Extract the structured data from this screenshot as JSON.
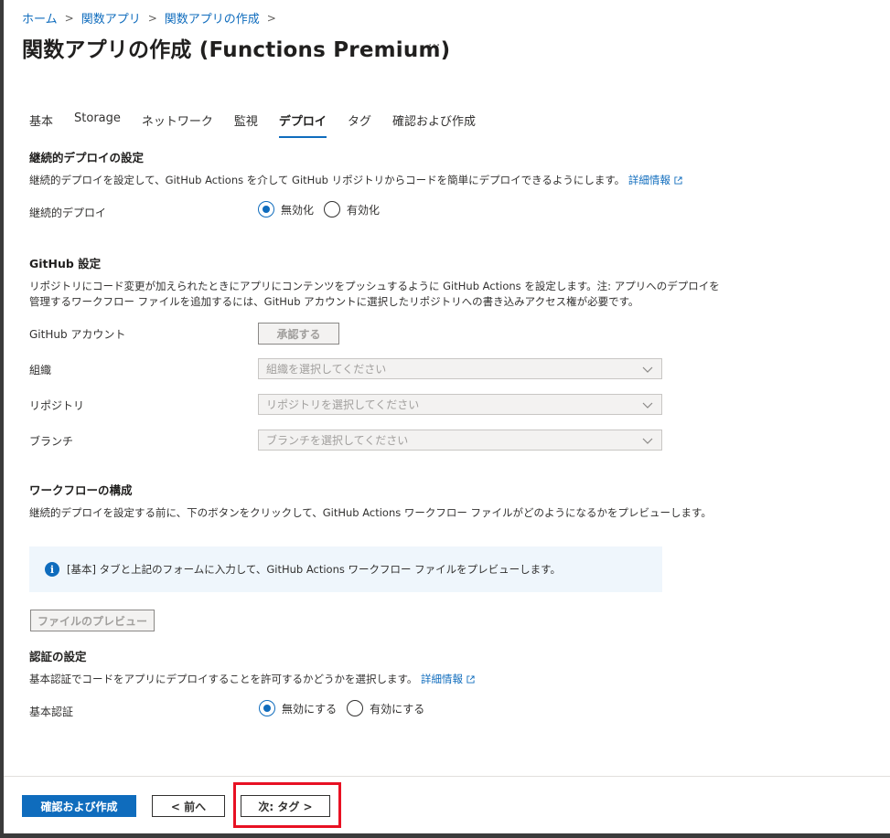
{
  "breadcrumb": {
    "items": [
      "ホーム",
      "関数アプリ",
      "関数アプリの作成"
    ],
    "separator": ">"
  },
  "page": {
    "title": "関数アプリの作成 (Functions Premium)",
    "more": "···"
  },
  "tabs": [
    {
      "label": "基本",
      "active": false
    },
    {
      "label": "Storage",
      "active": false
    },
    {
      "label": "ネットワーク",
      "active": false
    },
    {
      "label": "監視",
      "active": false
    },
    {
      "label": "デプロイ",
      "active": true
    },
    {
      "label": "タグ",
      "active": false
    },
    {
      "label": "確認および作成",
      "active": false
    }
  ],
  "cd": {
    "heading": "継続的デプロイの設定",
    "description": "継続的デプロイを設定して、GitHub Actions を介して GitHub リポジトリからコードを簡単にデプロイできるようにします。",
    "learn_more": "詳細情報",
    "label": "継続的デプロイ",
    "options": [
      "無効化",
      "有効化"
    ],
    "selected": "無効化"
  },
  "github": {
    "heading": "GitHub 設定",
    "desc_line1": "リポジトリにコード変更が加えられたときにアプリにコンテンツをプッシュするように GitHub Actions を設定します。注: アプリへのデプロイを",
    "desc_line2": "管理するワークフロー ファイルを追加するには、GitHub アカウントに選択したリポジトリへの書き込みアクセス権が必要です。",
    "account_label": "GitHub アカウント",
    "authorize_button": "承認する",
    "org_label": "組織",
    "org_placeholder": "組織を選択してください",
    "repo_label": "リポジトリ",
    "repo_placeholder": "リポジトリを選択してください",
    "branch_label": "ブランチ",
    "branch_placeholder": "ブランチを選択してください"
  },
  "workflow": {
    "heading": "ワークフローの構成",
    "description": "継続的デプロイを設定する前に、下のボタンをクリックして、GitHub Actions ワークフロー ファイルがどのようになるかをプレビューします。",
    "info": "[基本] タブと上記のフォームに入力して、GitHub Actions ワークフロー ファイルをプレビューします。",
    "preview_button": "ファイルのプレビュー"
  },
  "auth": {
    "heading": "認証の設定",
    "description": "基本認証でコードをアプリにデプロイすることを許可するかどうかを選択します。",
    "learn_more": "詳細情報",
    "label": "基本認証",
    "options": [
      "無効にする",
      "有効にする"
    ],
    "selected": "無効にする"
  },
  "footer": {
    "review_create": "確認および作成",
    "previous": "< 前へ",
    "next": "次: タグ >"
  },
  "colors": {
    "accent": "#0f6cbd",
    "highlight": "#e81123",
    "info_bg": "#eff6fc"
  }
}
